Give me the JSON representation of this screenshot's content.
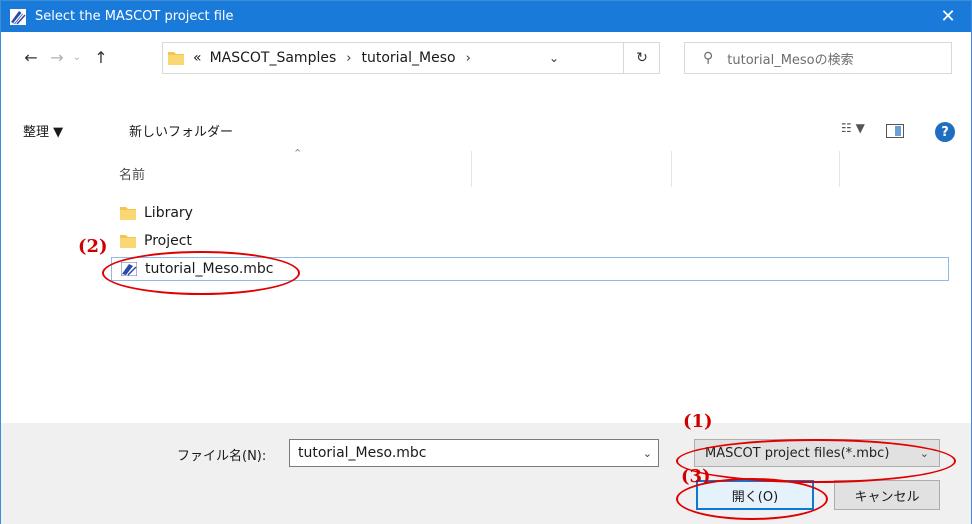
{
  "window": {
    "title": "Select the MASCOT project file",
    "close_glyph": "✕",
    "accent_color": "#1a7ad9"
  },
  "nav": {
    "back_glyph": "←",
    "forward_glyph": "→",
    "recent_glyph": "⌄",
    "up_glyph": "↑",
    "breadcrumb": {
      "overflow": "«",
      "items": [
        "MASCOT_Samples",
        "tutorial_Meso"
      ],
      "sep": "›",
      "trail_sep": "›"
    },
    "dropdown_glyph": "⌄",
    "refresh_glyph": "↻",
    "search_icon_glyph": "⚲",
    "search_placeholder": "tutorial_Mesoの検索"
  },
  "toolbar": {
    "organize_label": "整理 ▼",
    "new_folder_label": "新しいフォルダー",
    "view_label": "☷ ▼",
    "help_glyph": "?"
  },
  "filelist": {
    "name_header": "名前",
    "sort_glyph": "⌃",
    "items": [
      {
        "name": "Library",
        "type": "folder"
      },
      {
        "name": "Project",
        "type": "folder"
      },
      {
        "name": "tutorial_Meso.mbc",
        "type": "mbc",
        "selected": true
      }
    ]
  },
  "bottom": {
    "filename_label": "ファイル名(N):",
    "filename_value": "tutorial_Meso.mbc",
    "filename_dropdown_glyph": "⌄",
    "filter_value": "MASCOT project files(*.mbc)",
    "filter_dropdown_glyph": "⌄",
    "open_label": "開く(O)",
    "cancel_label": "キャンセル"
  },
  "annotations": {
    "label_1": "(1)",
    "label_2": "(2)",
    "label_3": "(3)",
    "color": "#e00000"
  }
}
